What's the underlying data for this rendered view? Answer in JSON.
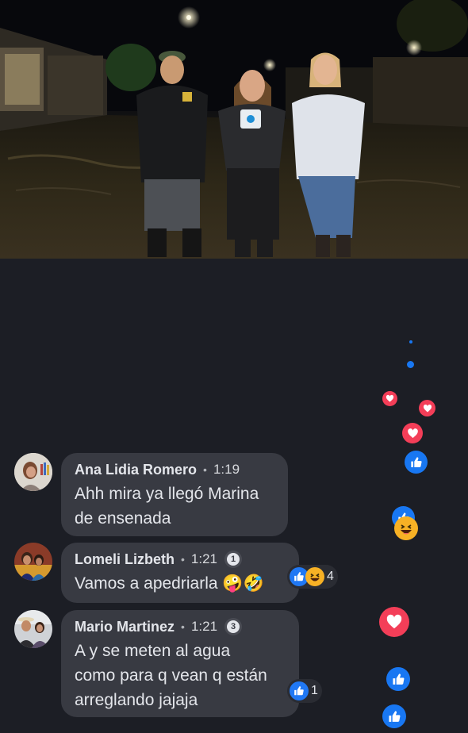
{
  "video": {
    "scene": "night street flooding report"
  },
  "comments": [
    {
      "name": "Ana Lidia Romero",
      "separator": "•",
      "time": "1:19",
      "badge": "",
      "text": "Ahh mira ya llegó Marina\nde ensenada",
      "reaction_count": ""
    },
    {
      "name": "Lomeli Lizbeth",
      "separator": "•",
      "time": "1:21",
      "badge": "1",
      "text": "Vamos a apedriarla 🤪🤣",
      "reaction_count": "4"
    },
    {
      "name": "Mario Martinez",
      "separator": "•",
      "time": "1:21",
      "badge": "3",
      "text": "A y se meten al agua\ncomo para q vean q están\narreglando jajaja",
      "reaction_count": "1"
    }
  ],
  "colors": {
    "background": "#1c1e25",
    "bubble": "#383a42",
    "like_blue": "#1877f2",
    "love_red": "#f33e58"
  },
  "icons": [
    "like-icon",
    "haha-icon",
    "heart-icon",
    "badge-icon"
  ]
}
